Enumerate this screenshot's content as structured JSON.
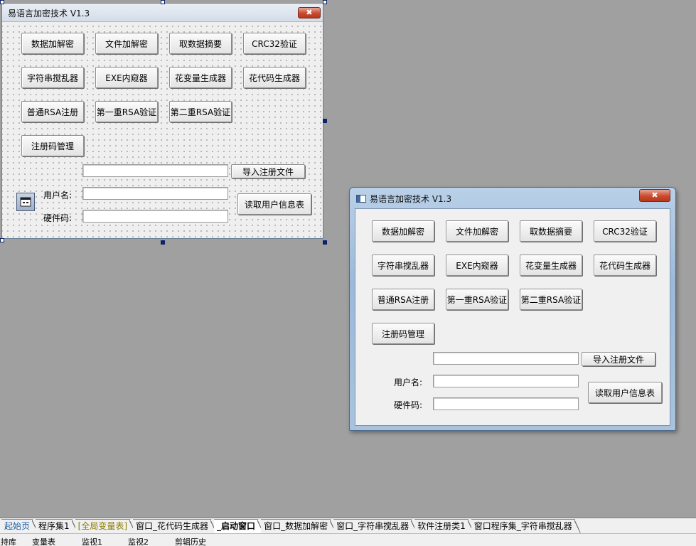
{
  "design_form": {
    "title": "易语言加密技术 V1.3",
    "close_glyph": "✖",
    "buttons": {
      "data_encrypt": "数据加解密",
      "file_encrypt": "文件加解密",
      "data_digest": "取数据摘要",
      "crc32": "CRC32验证",
      "string_scramble": "字符串搅乱器",
      "exe_peek": "EXE内窥器",
      "var_gen": "花变量生成器",
      "junk_code_gen": "花代码生成器",
      "rsa_register": "普通RSA注册",
      "rsa_verify_1": "第一重RSA验证",
      "rsa_verify_2": "第二重RSA验证",
      "regcode_manage": "注册码管理",
      "import_regfile": "导入注册文件",
      "read_userinfo": "读取用户信息表"
    },
    "labels": {
      "username": "用户名:",
      "hardware_code": "硬件码:"
    },
    "fields": {
      "regfile_path": "",
      "username": "",
      "hardware_code": ""
    }
  },
  "preview_window": {
    "title": "易语言加密技术 V1.3",
    "close_glyph": "✖",
    "buttons": {
      "data_encrypt": "数据加解密",
      "file_encrypt": "文件加解密",
      "data_digest": "取数据摘要",
      "crc32": "CRC32验证",
      "string_scramble": "字符串搅乱器",
      "exe_peek": "EXE内窥器",
      "var_gen": "花变量生成器",
      "junk_code_gen": "花代码生成器",
      "rsa_register": "普通RSA注册",
      "rsa_verify_1": "第一重RSA验证",
      "rsa_verify_2": "第二重RSA验证",
      "regcode_manage": "注册码管理",
      "import_regfile": "导入注册文件",
      "read_userinfo": "读取用户信息表"
    },
    "labels": {
      "username": "用户名:",
      "hardware_code": "硬件码:"
    },
    "fields": {
      "regfile_path": "",
      "username": "",
      "hardware_code": ""
    }
  },
  "tabs": [
    "起始页",
    "程序集1",
    "[全局变量表]",
    "窗口_花代码生成器",
    "_启动窗口",
    "窗口_数据加解密",
    "窗口_字符串搅乱器",
    "软件注册类1",
    "窗口程序集_字符串搅乱器"
  ],
  "status_items": [
    "支持库",
    "变量表",
    "监视1",
    "监视2",
    "剪辑历史"
  ],
  "colors": {
    "workspace": "#a0a0a0",
    "close_button": "#c94a2e",
    "active_tab_text": "#000000",
    "start_tab_text": "#1b5fa8",
    "global_var_tab_text": "#8b7a00"
  }
}
